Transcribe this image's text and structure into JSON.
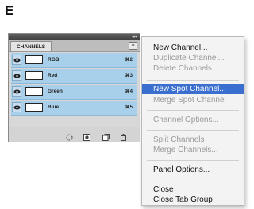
{
  "figure_label": "E",
  "panel": {
    "tab_label": "CHANNELS",
    "tab_close": "×",
    "collapse_glyph": "◂◂",
    "menu_button_glyph": "≡",
    "channels": [
      {
        "name": "RGB",
        "shortcut": "⌘2"
      },
      {
        "name": "Red",
        "shortcut": "⌘3"
      },
      {
        "name": "Green",
        "shortcut": "⌘4"
      },
      {
        "name": "Blue",
        "shortcut": "⌘5"
      }
    ],
    "footer_icons": [
      "load-selection-icon",
      "save-selection-icon",
      "new-channel-icon",
      "trash-icon"
    ],
    "row_color": "#a9d0ea"
  },
  "menu": {
    "highlight_color": "#3a6fcf",
    "items": [
      {
        "label": "New Channel...",
        "enabled": true
      },
      {
        "label": "Duplicate Channel...",
        "enabled": false
      },
      {
        "label": "Delete Channels",
        "enabled": false
      },
      {
        "label": "New Spot Channel...",
        "enabled": true,
        "highlighted": true
      },
      {
        "label": "Merge Spot Channel",
        "enabled": false
      },
      {
        "label": "Channel Options...",
        "enabled": false
      },
      {
        "label": "Split Channels",
        "enabled": false
      },
      {
        "label": "Merge Channels...",
        "enabled": false
      },
      {
        "label": "Panel Options...",
        "enabled": true
      },
      {
        "label": "Close",
        "enabled": true
      },
      {
        "label": "Close Tab Group",
        "enabled": true
      }
    ]
  }
}
